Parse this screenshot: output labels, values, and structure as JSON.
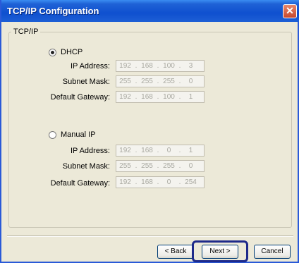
{
  "window": {
    "title": "TCP/IP Configuration",
    "close_label": "✕"
  },
  "group": {
    "legend": "TCP/IP"
  },
  "dhcp": {
    "label": "DHCP",
    "selected": true,
    "ip_label": "IP Address:",
    "ip": [
      "192",
      "168",
      "100",
      "3"
    ],
    "mask_label": "Subnet Mask:",
    "mask": [
      "255",
      "255",
      "255",
      "0"
    ],
    "gateway_label": "Default Gateway:",
    "gateway": [
      "192",
      "168",
      "100",
      "1"
    ]
  },
  "manual": {
    "label": "Manual IP",
    "selected": false,
    "ip_label": "IP Address:",
    "ip": [
      "192",
      "168",
      "0",
      "1"
    ],
    "mask_label": "Subnet Mask:",
    "mask": [
      "255",
      "255",
      "255",
      "0"
    ],
    "gateway_label": "Default Gateway:",
    "gateway": [
      "192",
      "168",
      "0",
      "254"
    ]
  },
  "buttons": {
    "back": "< Back",
    "next": "Next >",
    "cancel": "Cancel"
  },
  "colors": {
    "titlebar": "#0f50cf",
    "focus_ring": "#1e2a8a",
    "close": "#c8482e"
  }
}
